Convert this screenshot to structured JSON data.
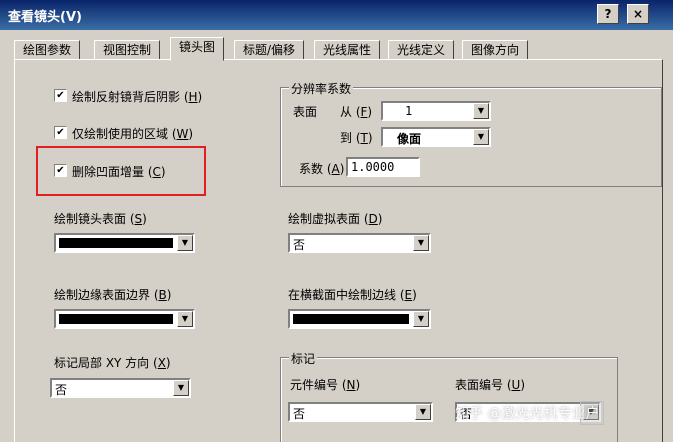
{
  "window": {
    "title": "查看镜头(V)",
    "help_btn": "?",
    "close_btn": "×"
  },
  "tabs": [
    {
      "label": "绘图参数"
    },
    {
      "label": "视图控制"
    },
    {
      "label": "镜头图"
    },
    {
      "label": "标题/偏移"
    },
    {
      "label": "光线属性"
    },
    {
      "label": "光线定义"
    },
    {
      "label": "图像方向"
    }
  ],
  "active_tab": "镜头图",
  "checkboxes": [
    {
      "label": "绘制反射镜背后阴影",
      "key": "H",
      "checked": true,
      "check": "✔"
    },
    {
      "label": "仅绘制使用的区域",
      "key": "W",
      "checked": true,
      "check": "✔"
    },
    {
      "label": "删除凹面增量",
      "key": "C",
      "checked": true,
      "check": "✔"
    }
  ],
  "resolution": {
    "title": "分辨率系数",
    "surface_label": "表面",
    "from_label": "从",
    "from_key": "F",
    "from_value": "1",
    "to_label": "到",
    "to_key": "T",
    "to_value": "像面",
    "coef_label": "系数",
    "coef_key": "A",
    "coef_value": "1.0000"
  },
  "fields": {
    "lens_surface": {
      "label": "绘制镜头表面",
      "key": "S",
      "value_color": "#000000"
    },
    "virtual_surface": {
      "label": "绘制虚拟表面",
      "key": "D",
      "value": "否"
    },
    "edge_boundary": {
      "label": "绘制边缘表面边界",
      "key": "B",
      "value_color": "#000000"
    },
    "cross_edge": {
      "label": "在横截面中绘制边线",
      "key": "E",
      "value_color": "#000000"
    },
    "local_xy": {
      "label": "标记局部 XY 方向",
      "key": "X",
      "value": "否"
    }
  },
  "marking": {
    "title": "标记",
    "element_label": "元件编号",
    "element_key": "N",
    "element_value": "否",
    "surface_label": "表面编号",
    "surface_key": "U",
    "surface_value": "否"
  },
  "watermark": "知乎 @激光光机专业户",
  "arrow_glyph": "▼"
}
